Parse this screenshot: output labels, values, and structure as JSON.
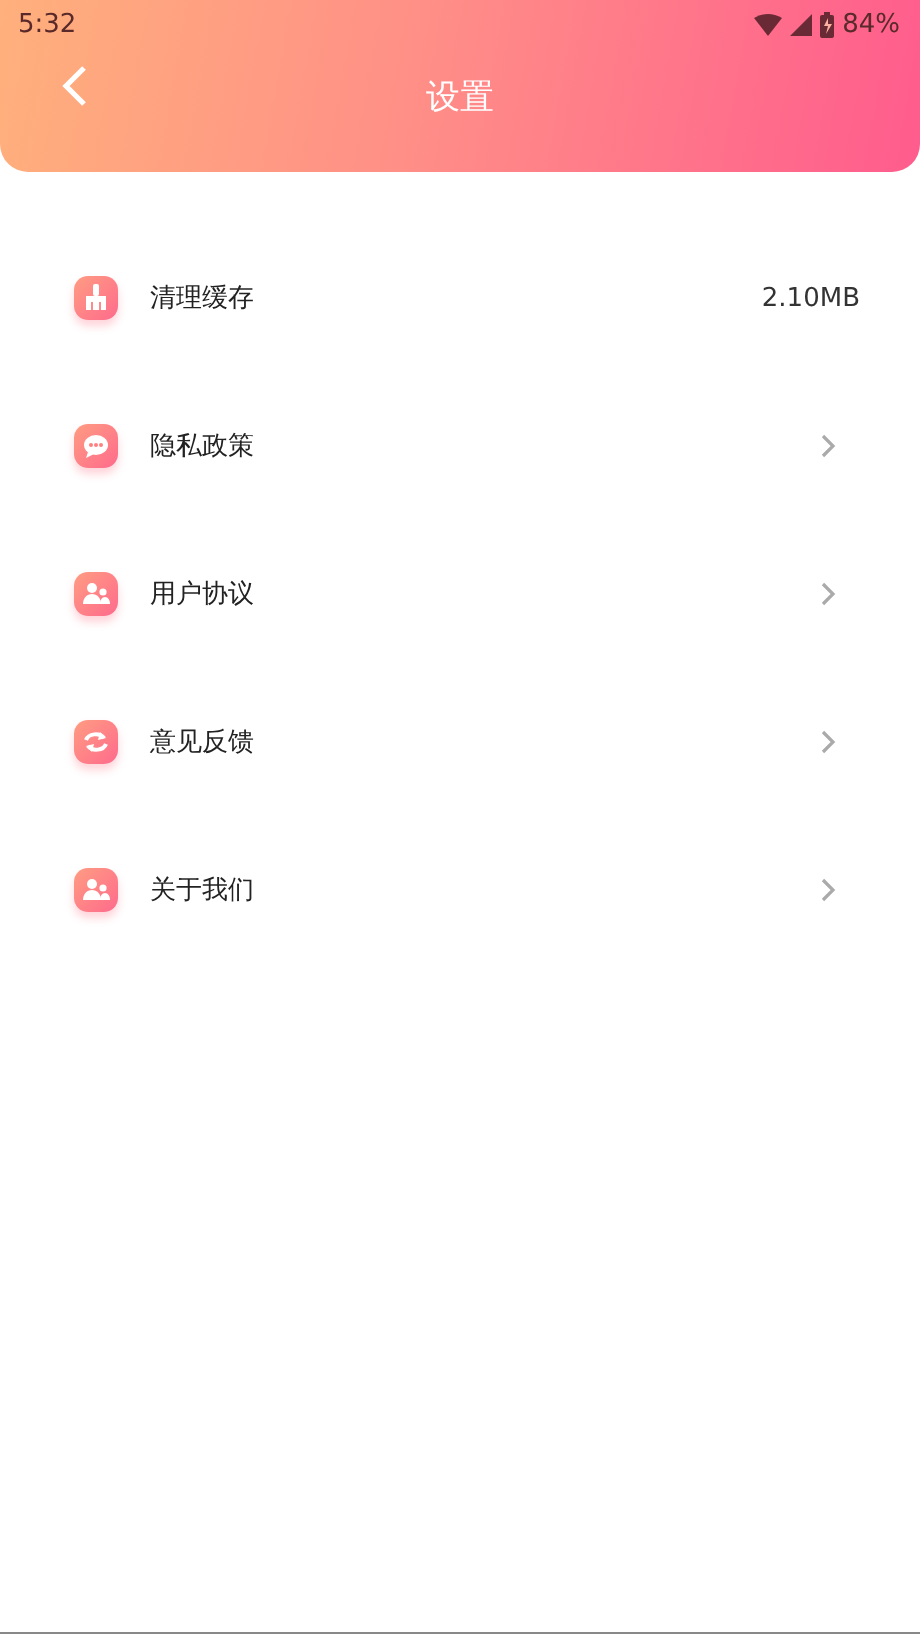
{
  "status_bar": {
    "time": "5:32",
    "battery": "84%"
  },
  "header": {
    "title": "设置"
  },
  "items": [
    {
      "label": "清理缓存",
      "kind": "value",
      "value": "2.10MB"
    },
    {
      "label": "隐私政策",
      "kind": "link"
    },
    {
      "label": "用户协议",
      "kind": "link"
    },
    {
      "label": "意见反馈",
      "kind": "link"
    },
    {
      "label": "关于我们",
      "kind": "link"
    }
  ]
}
